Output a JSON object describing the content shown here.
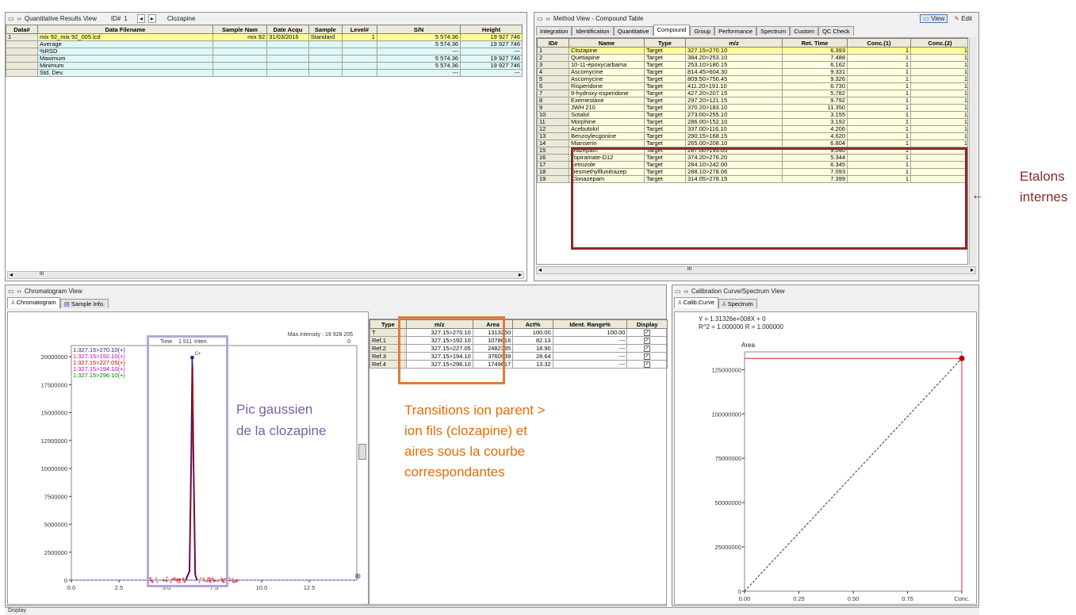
{
  "quant": {
    "title": "Quantitative Results View",
    "id_label": "ID#",
    "id_value": "1",
    "compound": "Clozapine",
    "headers": [
      "Data#",
      "Data Filename",
      "Sample Nam",
      "Date Acqu",
      "Sample",
      "Level#",
      "S/N",
      "Height"
    ],
    "rows": [
      [
        "1",
        "mix 92_mix 92_005.lcd",
        "mix 92",
        "31/03/2016",
        "Standard",
        "1",
        "5 574.36",
        "19 927 746"
      ],
      [
        "",
        "Average",
        "",
        "",
        "",
        "",
        "5 574.36",
        "19 927 746"
      ],
      [
        "",
        "%RSD",
        "",
        "",
        "",
        "",
        "---",
        "---"
      ],
      [
        "",
        "Maximum",
        "",
        "",
        "",
        "",
        "5 574.36",
        "19 927 746"
      ],
      [
        "",
        "Minimum",
        "",
        "",
        "",
        "",
        "5 574.36",
        "19 927 746"
      ],
      [
        "",
        "Std. Dev.",
        "",
        "",
        "",
        "",
        "---",
        "---"
      ]
    ],
    "scroll_mark": "III"
  },
  "method": {
    "title": "Method View - Compound Table",
    "view_btn": "View",
    "edit_btn": "Edit",
    "tabs": [
      "Integration",
      "Identification",
      "Quantitative",
      "Compound",
      "Group",
      "Performance",
      "Spectrum",
      "Custom",
      "QC Check"
    ],
    "headers": [
      "ID#",
      "Name",
      "Type",
      "m/z",
      "Ret. Time",
      "Conc.(1)",
      "Conc.(2)"
    ],
    "rows": [
      [
        "1",
        "Clozapine",
        "Target",
        "327.15>270.10",
        "6.393",
        "1",
        "1"
      ],
      [
        "2",
        "Quetiapine",
        "Target",
        "384.20>253.10",
        "7.488",
        "1",
        "1"
      ],
      [
        "3",
        "10-11-epoxycarbama",
        "Target",
        "253.10>180.15",
        "6.162",
        "1",
        "1"
      ],
      [
        "4",
        "Ascomycine",
        "Target",
        "814.45>604.30",
        "9.331",
        "1",
        "1"
      ],
      [
        "5",
        "Ascomycine",
        "Target",
        "809.50>756.45",
        "9.326",
        "1",
        "1"
      ],
      [
        "6",
        "Risperidone",
        "Target",
        "411.20>191.10",
        "6.730",
        "1",
        "1"
      ],
      [
        "7",
        "9-hydroxy-risperidone",
        "Target",
        "427.20>207.15",
        "5.782",
        "1",
        "1"
      ],
      [
        "8",
        "Exemestane",
        "Target",
        "297.20>121.15",
        "9.792",
        "1",
        "1"
      ],
      [
        "9",
        "JWH 210",
        "Target",
        "370.20>183.10",
        "11.350",
        "1",
        "1"
      ],
      [
        "10",
        "Sotalol",
        "Target",
        "273.00>255.10",
        "3.155",
        "1",
        "1"
      ],
      [
        "11",
        "Morphine",
        "Target",
        "286.00>152.10",
        "3.192",
        "1",
        "1"
      ],
      [
        "12",
        "Acebutolol",
        "Target",
        "337.00>116.10",
        "4.206",
        "1",
        "1"
      ],
      [
        "13",
        "Benzoylecgonine",
        "Target",
        "290.15>168.15",
        "4.620",
        "1",
        "1"
      ],
      [
        "14",
        "Mianserin",
        "Target",
        "265.00>208.10",
        "6.804",
        "1",
        "1"
      ],
      [
        "15",
        "Diazepam",
        "Target",
        "287.00>193.05",
        "9.040",
        "1",
        "1"
      ],
      [
        "16",
        "Topiramate-D12",
        "Target",
        "374.20>276.20",
        "5.344",
        "1",
        "1"
      ],
      [
        "17",
        "Letrozole",
        "Target",
        "284.10>242.00",
        "6.345",
        "1",
        "1"
      ],
      [
        "18",
        "Desmethylflunitrazep",
        "Target",
        "288.10>278.06",
        "7.093",
        "1",
        "1"
      ],
      [
        "19",
        "Clonazepam",
        "Target",
        "314.05>278.15",
        "7.399",
        "1",
        "1"
      ]
    ],
    "scroll_mark": "III"
  },
  "chrom": {
    "title": "Chromatogram View",
    "tabs": [
      "Chromatogram",
      "Sample Info."
    ],
    "max_intensity": "Max.Intensity : 19 928 205",
    "time_label": "Time",
    "time_value": "1.511",
    "inten_label": "Inten.",
    "inten_value": "0",
    "legend": [
      {
        "text": "1:327.15>270.10(+)",
        "color": "#1a1a8c"
      },
      {
        "text": "1:327.15>192.10(+)",
        "color": "#c000c0"
      },
      {
        "text": "1:327.15>227.05(+)",
        "color": "#c00000"
      },
      {
        "text": "1:327.15>194.10(+)",
        "color": "#c000c0"
      },
      {
        "text": "1:327.15>296.10(+)",
        "color": "#008000"
      }
    ],
    "yticks": [
      "20000000",
      "17500000",
      "15000000",
      "12500000",
      "10000000",
      "7500000",
      "5000000",
      "2500000",
      "0"
    ],
    "xticks": [
      "0.0",
      "2.5",
      "5.0",
      "7.5",
      "10.0",
      "12.5"
    ],
    "peak_label": "C+"
  },
  "ion_table": {
    "headers": [
      "Type",
      "m/z",
      "Area",
      "Act%",
      "Ident. Range%",
      "Display"
    ],
    "rows": [
      [
        "T",
        "327.15>270.10",
        "1313250",
        "100.00",
        "100.00"
      ],
      [
        "Ref.1",
        "327.15>192.10",
        "1078616",
        "82.13",
        "---"
      ],
      [
        "Ref.2",
        "327.15>227.05",
        "2482385",
        "18.90",
        "---"
      ],
      [
        "Ref.3",
        "327.15>194.10",
        "3760939",
        "28.64",
        "---"
      ],
      [
        "Ref.4",
        "327.15>296.10",
        "1749617",
        "13.32",
        "---"
      ]
    ]
  },
  "calib": {
    "title": "Calibration Curve/Spectrum View",
    "tabs": [
      "Calib.Curve",
      "Spectrum"
    ],
    "equation": "Y = 1.31326e+008X + 0",
    "r2": "R^2 = 1.000000  R = 1.000000",
    "ylabel": "Area",
    "yticks": [
      "125000000",
      "100000000",
      "75000000",
      "50000000",
      "25000000",
      "0"
    ],
    "xticks": [
      "0.00",
      "0.25",
      "0.50",
      "0.75",
      "Conc."
    ]
  },
  "annotations": {
    "etalons": "Etalons\ninternes",
    "pic": "Pic gaussien\nde la clozapine",
    "transitions": "Transitions ion parent >\nion fils (clozapine) et\naires sous la courbe\ncorrespondantes"
  },
  "status": {
    "label": "Display"
  },
  "colors": {
    "highlight": "#ffff99",
    "row_cyan": "#dff7f7",
    "row_yellow": "#ffffdd",
    "red_box": "#8b2a2a",
    "purple": "#7b5ea7",
    "orange": "#e36c09"
  },
  "chart_data": [
    {
      "type": "line",
      "title": "",
      "xlabel": "",
      "ylabel": "",
      "xlim": [
        0,
        15
      ],
      "ylim": [
        0,
        21000000
      ],
      "series": [
        {
          "name": "1:327.15>270.10(+)",
          "x": [
            6.0,
            6.2,
            6.3,
            6.35,
            6.4,
            6.5,
            6.6
          ],
          "values": [
            0,
            800000,
            12000000,
            19928205,
            12000000,
            500000,
            0
          ]
        }
      ]
    },
    {
      "type": "line",
      "title": "",
      "xlabel": "Conc.",
      "ylabel": "Area",
      "xlim": [
        0,
        1
      ],
      "ylim": [
        0,
        135000000
      ],
      "series": [
        {
          "name": "",
          "x": [
            0,
            1
          ],
          "values": [
            0,
            131326000
          ]
        }
      ],
      "point": {
        "x": 1,
        "y": 131326000
      }
    }
  ]
}
